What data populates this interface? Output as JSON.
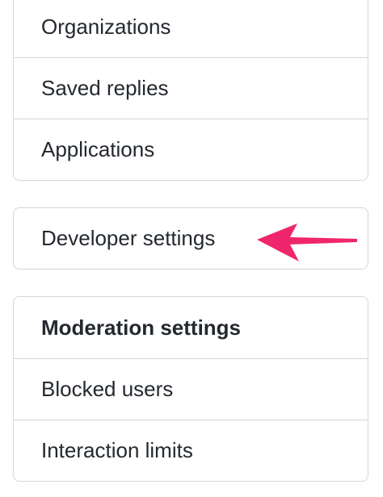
{
  "menu_top": {
    "items": [
      {
        "label": "Organizations"
      },
      {
        "label": "Saved replies"
      },
      {
        "label": "Applications"
      }
    ]
  },
  "menu_developer": {
    "items": [
      {
        "label": "Developer settings"
      }
    ]
  },
  "menu_moderation": {
    "header": "Moderation settings",
    "items": [
      {
        "label": "Blocked users"
      },
      {
        "label": "Interaction limits"
      }
    ]
  },
  "annotation": {
    "arrow_color": "#f0266c",
    "icon": "pointer-arrow-icon"
  }
}
